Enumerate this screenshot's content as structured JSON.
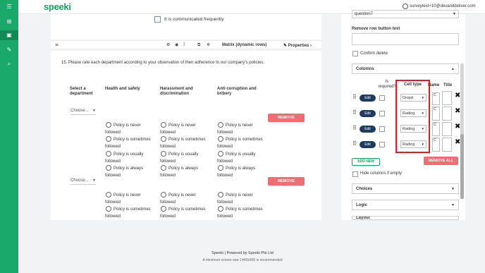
{
  "app": {
    "logo_text": "speeki",
    "user_email": "surveytest+10@devanddeliver.com"
  },
  "nav": {
    "icons": [
      "menu-icon",
      "grid-icon",
      "survey-icon",
      "edit-icon",
      "search-icon"
    ]
  },
  "prev_question": {
    "checkbox_label": "It is communicated frequently"
  },
  "toolbar": {
    "question_type": "Matrix (dynamic rows)",
    "properties_label": "Properties"
  },
  "question": {
    "title": "15.   Please rate each department according to your observation of their adherence to our company's policies.",
    "columns": {
      "select": "Select a department",
      "health": "Health and safety",
      "harassment": "Harassment and discrimination",
      "corruption": "Anti corruption and bribery"
    },
    "choose_placeholder": "Choose...",
    "options": [
      "Policy is never followed",
      "Policy is sometimes followed",
      "Policy is usually followed",
      "Policy is always followed"
    ],
    "remove_label": "REMOVE"
  },
  "panel": {
    "top_select_value": "question7",
    "remove_row_label": "Remove row button text",
    "confirm_delete_label": "Confirm delete",
    "columns_section": "Columns",
    "headers": {
      "is_required": "Is required?",
      "cell_type": "Cell type",
      "name": "Name",
      "title": "Title"
    },
    "rows": [
      {
        "edit": "Edit",
        "cell_type": "Dropd",
        "name": "C"
      },
      {
        "edit": "Edit",
        "cell_type": "Radiog",
        "name": "C"
      },
      {
        "edit": "Edit",
        "cell_type": "Radiog",
        "name": "C"
      },
      {
        "edit": "Edit",
        "cell_type": "Radiog",
        "name": "C"
      }
    ],
    "add_new_label": "ADD NEW",
    "remove_all_label": "REMOVE ALL",
    "hide_columns_label": "Hide columns if empty",
    "choices_section": "Choices",
    "logic_section": "Logic",
    "layout_section": "Layout"
  },
  "footer": {
    "line1_brand": "Speeki",
    "line1_sep": "|",
    "line1_powered": "Powered by Speeki Pte Ltd",
    "line2": "A minimum screen size 1440x900 is recommended"
  }
}
